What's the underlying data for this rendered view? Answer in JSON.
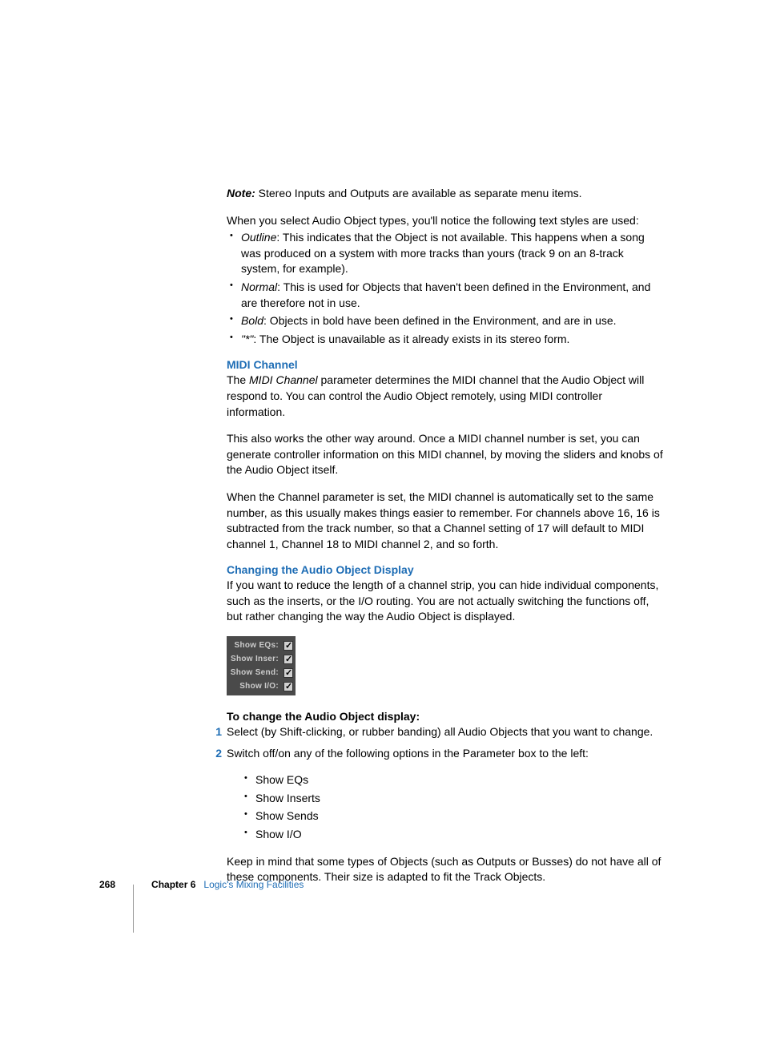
{
  "note": {
    "label": "Note:",
    "text": "Stereo Inputs and Outputs are available as separate menu items."
  },
  "intro_text": "When you select Audio Object types, you'll notice the following text styles are used:",
  "text_styles": [
    {
      "term": "Outline",
      "desc": ":  This indicates that the Object is not available. This happens when a song was produced on a system with more tracks than yours (track 9 on an 8-track system, for example)."
    },
    {
      "term": "Normal",
      "desc": ":  This is used for Objects that haven't been defined in the Environment, and are therefore not in use."
    },
    {
      "term": "Bold",
      "desc": ":  Objects in bold have been defined in the Environment, and are in use."
    },
    {
      "term": "\"*\"",
      "desc": ":  The Object is unavailable as it already exists in its stereo form."
    }
  ],
  "midi_channel": {
    "heading": "MIDI Channel",
    "p1_prefix": "The ",
    "p1_term": "MIDI Channel",
    "p1_suffix": " parameter determines the MIDI channel that the Audio Object will respond to. You can control the Audio Object remotely, using MIDI controller information.",
    "p2": "This also works the other way around. Once a MIDI channel number is set, you can generate controller information on this MIDI channel, by moving the sliders and knobs of the Audio Object itself.",
    "p3": "When the Channel parameter is set, the MIDI channel is automatically set to the same number, as this usually makes things easier to remember. For channels above 16, 16 is subtracted from the track number, so that a Channel setting of 17 will default to MIDI channel 1, Channel 18 to MIDI channel 2, and so forth."
  },
  "changing_display": {
    "heading": "Changing the Audio Object Display",
    "p1": "If you want to reduce the length of a channel strip, you can hide individual components, such as the inserts, or the I/O routing. You are not actually switching the functions off, but rather changing the way the Audio Object is displayed."
  },
  "figure_rows": [
    "Show EQs:",
    "Show Inser:",
    "Show Send:",
    "Show I/O:"
  ],
  "procedure": {
    "heading": "To change the Audio Object display:",
    "steps": [
      {
        "num": "1",
        "text": "Select (by Shift-clicking, or rubber banding) all Audio Objects that you want to change."
      },
      {
        "num": "2",
        "text": "Switch off/on any of the following options in the Parameter box to the left:"
      }
    ],
    "options": [
      "Show EQs",
      "Show Inserts",
      "Show Sends",
      "Show I/O"
    ],
    "closing": "Keep in mind that some types of Objects (such as Outputs or Busses) do not have all of these components. Their size is adapted to fit the Track Objects."
  },
  "footer": {
    "page": "268",
    "chapter": "Chapter 6",
    "title": "Logic's Mixing Facilities"
  }
}
